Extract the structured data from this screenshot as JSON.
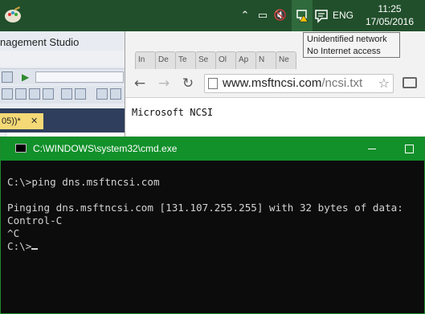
{
  "taskbar": {
    "language": "ENG",
    "time": "11:25",
    "date": "17/05/2016",
    "tray_icons": [
      "chevron-up-icon",
      "power-icon",
      "volume-muted-icon",
      "network-warning-icon",
      "action-center-icon"
    ]
  },
  "tooltip": {
    "line1": "Unidentified network",
    "line2": "No Internet access"
  },
  "ssms": {
    "title_fragment": "nagement Studio",
    "tab_label": "05))*",
    "tab_close": "✕"
  },
  "chrome": {
    "tabs": [
      "In",
      "De",
      "Te",
      "Se",
      "Ol",
      "Ap",
      "N",
      "Ne"
    ],
    "url_host": "www.msftncsi.com",
    "url_path": "/ncsi.txt",
    "content": "Microsoft NCSI"
  },
  "cmd": {
    "title": "C:\\WINDOWS\\system32\\cmd.exe",
    "lines": [
      "C:\\>ping dns.msftncsi.com",
      "",
      "Pinging dns.msftncsi.com [131.107.255.255] with 32 bytes of data:",
      "Control-C",
      "^C",
      "C:\\>"
    ]
  },
  "colors": {
    "taskbar": "#214f2b",
    "cmd_title": "#12902a",
    "cmd_bg": "#0c0c0c",
    "ssms_tab": "#f5d976"
  }
}
